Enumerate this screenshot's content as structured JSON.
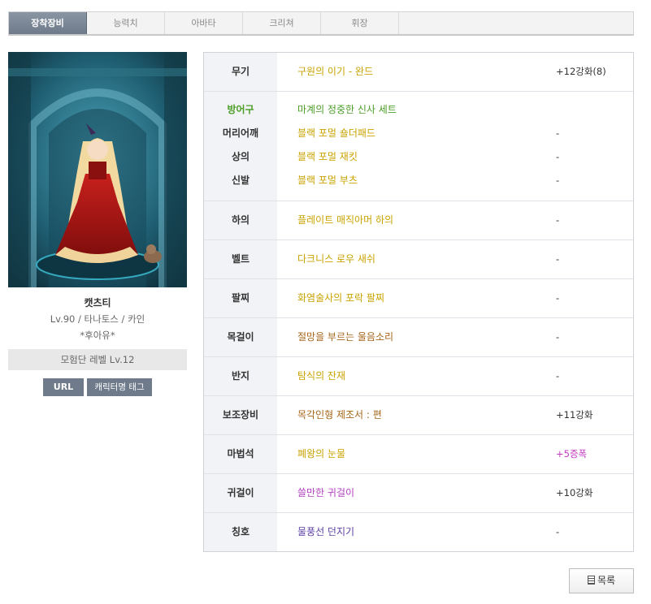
{
  "tabs": [
    {
      "label": "장착장비",
      "active": true
    },
    {
      "label": "능력치",
      "active": false
    },
    {
      "label": "아바타",
      "active": false
    },
    {
      "label": "크리쳐",
      "active": false
    },
    {
      "label": "휘장",
      "active": false
    }
  ],
  "character": {
    "name": "캣츠티",
    "info": "Lv.90 / 타나토스 / 카인",
    "guild": "*후아유*",
    "adventure_level": "모험단 레벨 Lv.12",
    "url_button": "URL",
    "tag_button": "캐릭터명 태그"
  },
  "equipment": {
    "weapon": {
      "slot": "무기",
      "item": "구원의 이기 - 완드",
      "value": "+12강화(8)"
    },
    "armor_set": {
      "slot": "방어구",
      "item": "마계의 정중한 신사 세트"
    },
    "shoulder": {
      "slot": "머리어깨",
      "item": "블랙 포멀 숄더패드",
      "value": "-"
    },
    "top": {
      "slot": "상의",
      "item": "블랙 포멀 재킷",
      "value": "-"
    },
    "shoes": {
      "slot": "신발",
      "item": "블랙 포멀 부츠",
      "value": "-"
    },
    "bottom": {
      "slot": "하의",
      "item": "플레이트 매직아머 하의",
      "value": "-"
    },
    "belt": {
      "slot": "벨트",
      "item": "다크니스 로우 새쉬",
      "value": "-"
    },
    "bracelet": {
      "slot": "팔찌",
      "item": "화염술사의 포락 팔찌",
      "value": "-"
    },
    "necklace": {
      "slot": "목걸이",
      "item": "절망을 부르는 울음소리",
      "value": "-"
    },
    "ring": {
      "slot": "반지",
      "item": "탐식의 잔재",
      "value": "-"
    },
    "sub": {
      "slot": "보조장비",
      "item": "목각인형 제조서 : 편",
      "value": "+11강화"
    },
    "magic_stone": {
      "slot": "마법석",
      "item": "폐왕의 눈물",
      "value": "+5증폭"
    },
    "earring": {
      "slot": "귀걸이",
      "item": "쓸만한 귀걸이",
      "value": "+10강화"
    },
    "title": {
      "slot": "칭호",
      "item": "물풍선 던지기",
      "value": "-"
    }
  },
  "footer": {
    "list_button": "목록"
  },
  "colors": {
    "tab_active": "#6f7b8b",
    "set_green": "#4a9d25",
    "unique_yellow": "#c9a300",
    "rare_pink": "#c43cc4"
  }
}
